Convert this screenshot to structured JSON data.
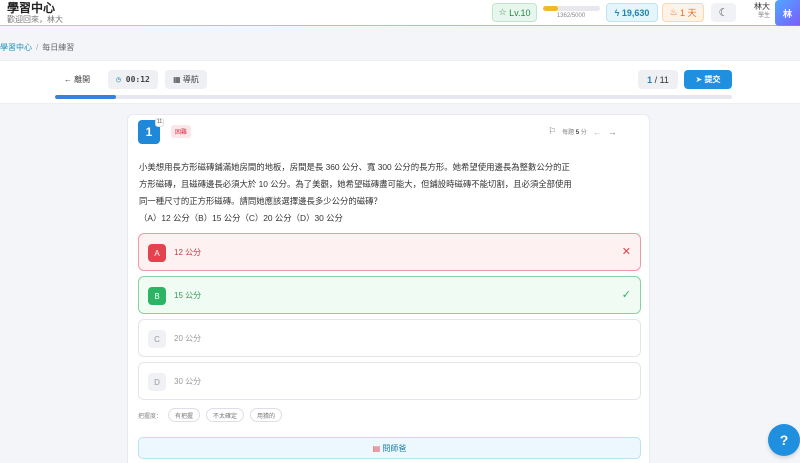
{
  "header": {
    "title": "學習中心",
    "subtitle": "歡迎回來，林大",
    "level": "Lv.10",
    "xp_text": "1362/5000",
    "xp_fraction": 0.27,
    "coins": "19,630",
    "streak": "1 天",
    "user_name": "林大",
    "user_role": "學生",
    "avatar_text": "林"
  },
  "breadcrumb": {
    "root": "學習中心",
    "current": "每日練習"
  },
  "toolbar": {
    "leave_label": "離開",
    "timer": "00:12",
    "nav_label": "導航",
    "current": "1",
    "total": "11",
    "submit_label": "提交",
    "progress_fraction": 0.09
  },
  "question": {
    "number": "1",
    "sup": "11",
    "tag": "困難",
    "points_prefix": "每題",
    "points_value": "5",
    "points_suffix": "分",
    "text_lines": [
      "小美想用長方形磁磚鋪滿她房間的地板，房間是長 360 公分、寬 300 公分的長方形。她希望使用邊長為整數公分的正",
      "方形磁磚，且磁磚邊長必須大於 10 公分。為了美觀，她希望磁磚盡可能大，但鋪設時磁磚不能切割，且必須全部使用",
      "同一種尺寸的正方形磁磚。請問她應該選擇邊長多少公分的磁磚？",
      "（A）12 公分（B）15 公分（C）20 公分（D）30 公分"
    ],
    "options": [
      {
        "letter": "A",
        "text": "12 公分",
        "state": "wrong"
      },
      {
        "letter": "B",
        "text": "15 公分",
        "state": "right"
      },
      {
        "letter": "C",
        "text": "20 公分",
        "state": "none"
      },
      {
        "letter": "D",
        "text": "30 公分",
        "state": "none"
      }
    ],
    "mastery_label": "把握度：",
    "mastery_choices": [
      "有把握",
      "不太確定",
      "用猜的"
    ],
    "ask_label": "問師爸"
  },
  "colors": {
    "primary": "#1f8fe0",
    "wrong": "#e2434e",
    "right": "#2bb463",
    "hard": "#d9334a"
  }
}
